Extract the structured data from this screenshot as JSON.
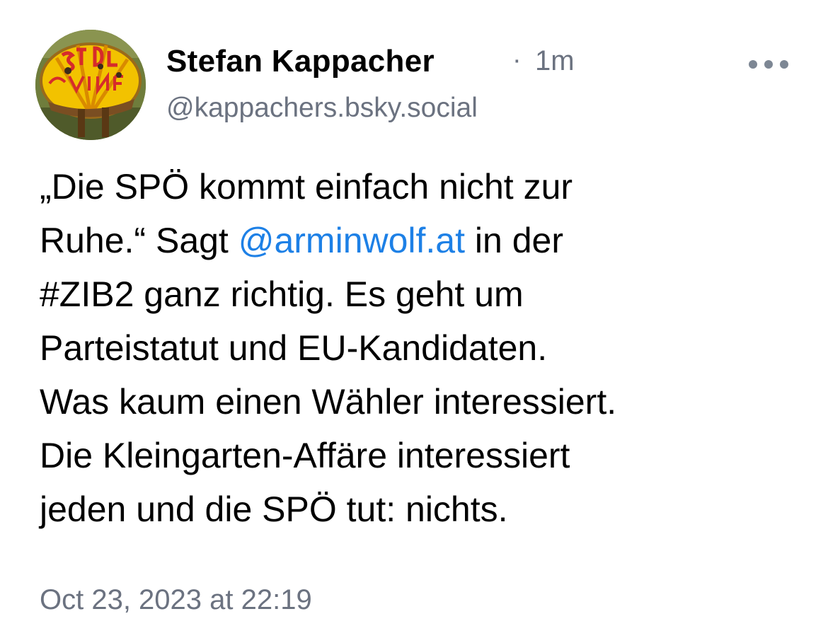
{
  "post": {
    "author": {
      "display_name": "Stefan Kappacher",
      "handle": "@kappachers.bsky.social"
    },
    "meta_separator": "·",
    "time_ago": "1m",
    "more_icon": "ellipsis-icon",
    "text_lines": {
      "line1": "„Die SPÖ kommt einfach nicht zur",
      "line2_before": "Ruhe.“ Sagt ",
      "line2_mention": "@arminwolf.at",
      "line2_after": " in der",
      "line3": "#ZIB2 ganz richtig. Es geht um",
      "line4": "Parteistatut und EU-Kandidaten.",
      "line5": "Was kaum einen Wähler interessiert.",
      "line6": "Die Kleingarten-Affäre interessiert",
      "line7": "jeden und die SPÖ tut: nichts."
    },
    "timestamp": "Oct 23, 2023 at 22:19",
    "colors": {
      "mention": "#1d80e6",
      "secondary_text": "#6b7280",
      "text": "#000000",
      "background": "#ffffff"
    }
  }
}
